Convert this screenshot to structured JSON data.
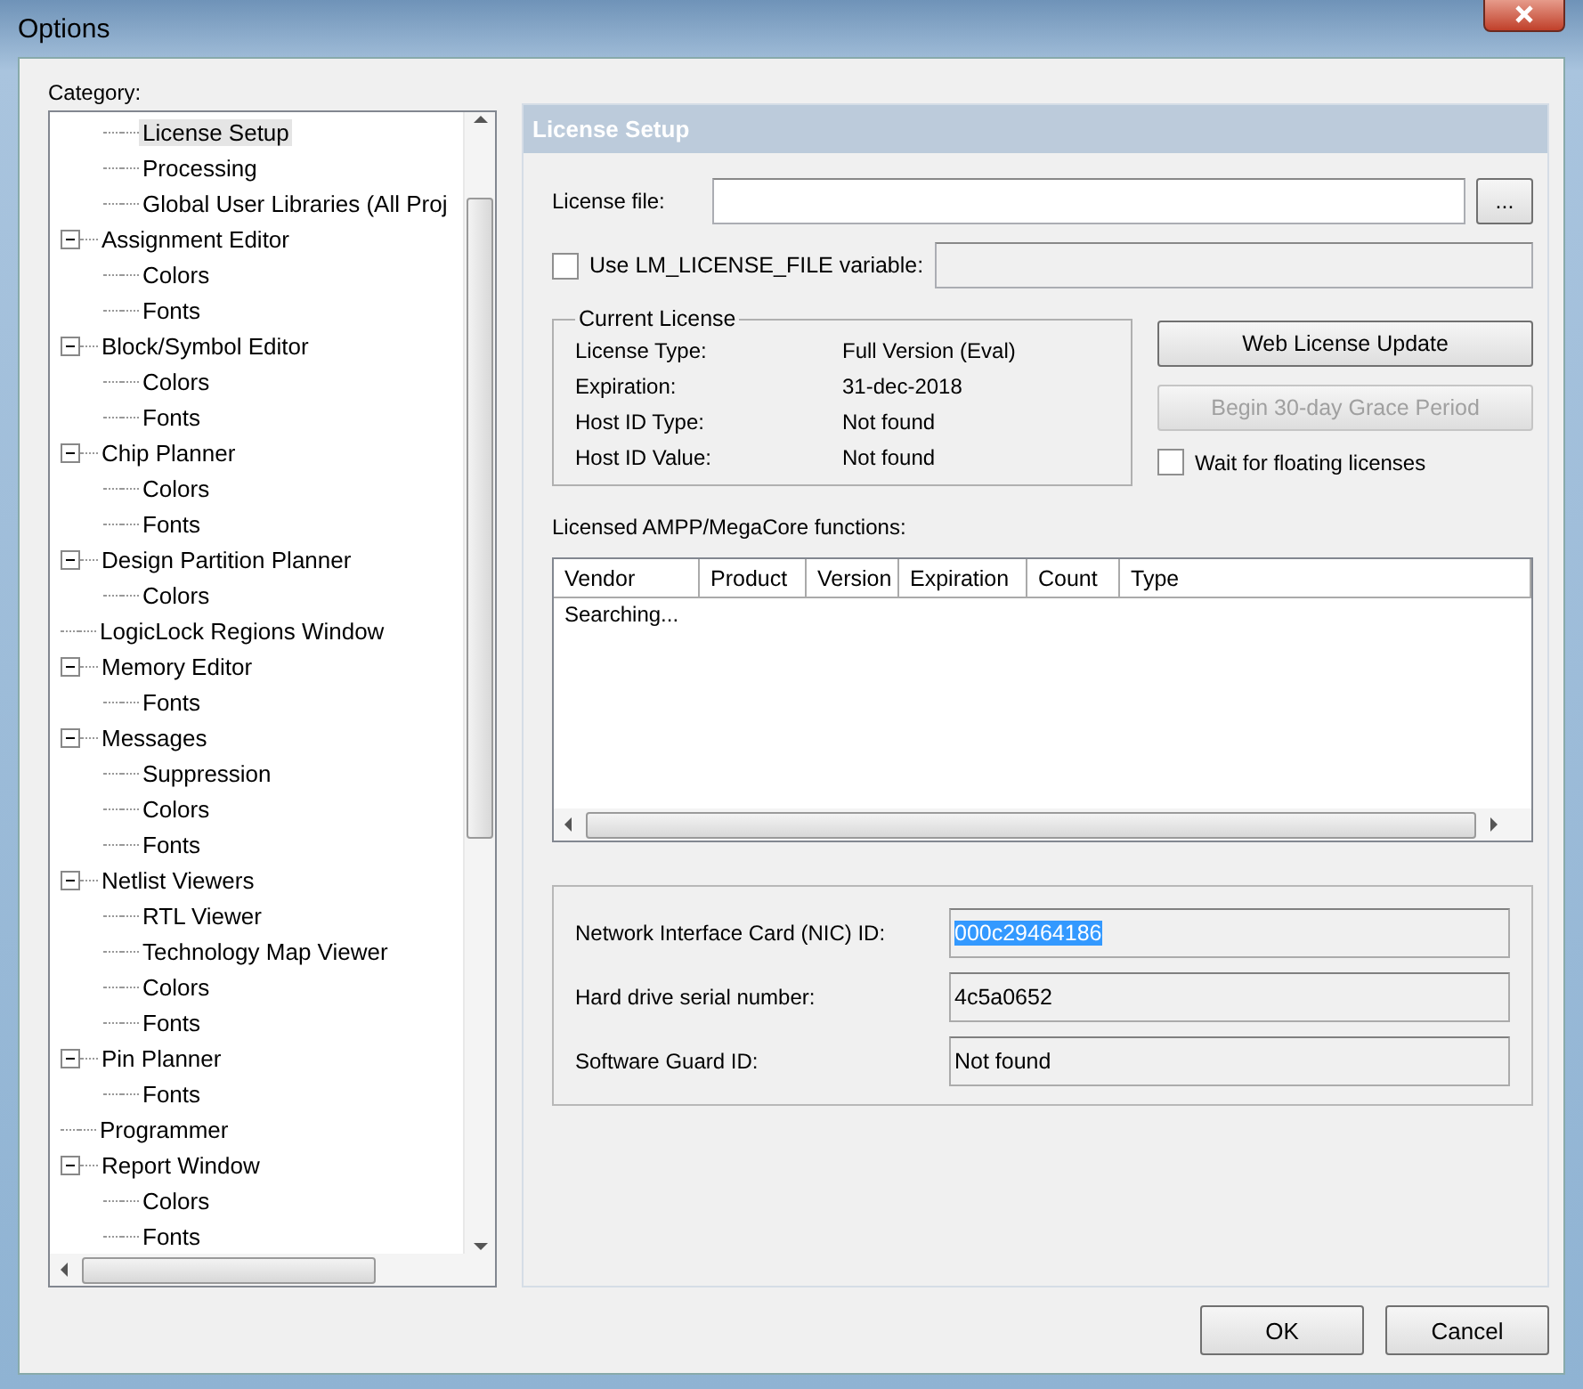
{
  "window": {
    "title": "Options"
  },
  "category": {
    "label": "Category:",
    "tree": [
      {
        "children": [
          {
            "label": "License Setup",
            "selected": true
          },
          {
            "label": "Processing",
            "selected": false
          },
          {
            "label": "Global User Libraries (All Proj",
            "selected": false
          }
        ]
      },
      {
        "label": "Assignment Editor",
        "selected": false,
        "expanded": true,
        "children": [
          {
            "label": "Colors",
            "selected": false
          },
          {
            "label": "Fonts",
            "selected": false
          }
        ]
      },
      {
        "label": "Block/Symbol Editor",
        "selected": false,
        "expanded": true,
        "children": [
          {
            "label": "Colors",
            "selected": false
          },
          {
            "label": "Fonts",
            "selected": false
          }
        ]
      },
      {
        "label": "Chip Planner",
        "selected": false,
        "expanded": true,
        "children": [
          {
            "label": "Colors",
            "selected": false
          },
          {
            "label": "Fonts",
            "selected": false
          }
        ]
      },
      {
        "label": "Design Partition Planner",
        "selected": false,
        "expanded": true,
        "children": [
          {
            "label": "Colors",
            "selected": false
          }
        ]
      },
      {
        "label": "LogicLock Regions Window",
        "selected": false
      },
      {
        "label": "Memory Editor",
        "selected": false,
        "expanded": true,
        "children": [
          {
            "label": "Fonts",
            "selected": false
          }
        ]
      },
      {
        "label": "Messages",
        "selected": false,
        "expanded": true,
        "children": [
          {
            "label": "Suppression",
            "selected": false
          },
          {
            "label": "Colors",
            "selected": false
          },
          {
            "label": "Fonts",
            "selected": false
          }
        ]
      },
      {
        "label": "Netlist Viewers",
        "selected": false,
        "expanded": true,
        "children": [
          {
            "label": "RTL Viewer",
            "selected": false
          },
          {
            "label": "Technology Map Viewer",
            "selected": false
          },
          {
            "label": "Colors",
            "selected": false
          },
          {
            "label": "Fonts",
            "selected": false
          }
        ]
      },
      {
        "label": "Pin Planner",
        "selected": false,
        "expanded": true,
        "children": [
          {
            "label": "Fonts",
            "selected": false
          }
        ]
      },
      {
        "label": "Programmer",
        "selected": false
      },
      {
        "label": "Report Window",
        "selected": false,
        "expanded": true,
        "children": [
          {
            "label": "Colors",
            "selected": false
          },
          {
            "label": "Fonts",
            "selected": false
          }
        ]
      }
    ]
  },
  "panel": {
    "title": "License Setup",
    "license_file": {
      "label": "License file:",
      "browse": "..."
    },
    "use_lm_license_file": {
      "label": "Use LM_LICENSE_FILE variable:",
      "checked": false
    },
    "current_license": {
      "title": "Current License",
      "rows": [
        {
          "label": "License Type:",
          "value": "Full Version (Eval)"
        },
        {
          "label": "Expiration:",
          "value": "31-dec-2018"
        },
        {
          "label": "Host ID Type:",
          "value": "Not found"
        },
        {
          "label": "Host ID Value:",
          "value": "Not found"
        }
      ]
    },
    "web_license_update": {
      "label": "Web License Update",
      "disabled": false
    },
    "grace_period": {
      "label": "Begin 30-day Grace Period",
      "disabled": true
    },
    "wait_floating": {
      "label": "Wait for floating licenses",
      "checked": false
    },
    "functions": {
      "label": "Licensed AMPP/MegaCore functions:",
      "columns": [
        "Vendor",
        "Product",
        "Version",
        "Expiration",
        "Count",
        "Type"
      ],
      "status": "Searching..."
    },
    "ids": [
      {
        "label": "Network Interface Card (NIC) ID:",
        "value": "000c29464186",
        "selected": true
      },
      {
        "label": "Hard drive serial number:",
        "value": "4c5a0652",
        "selected": false
      },
      {
        "label": "Software Guard ID:",
        "value": "Not found",
        "selected": false
      }
    ]
  },
  "buttons": [
    "OK",
    "Cancel"
  ]
}
